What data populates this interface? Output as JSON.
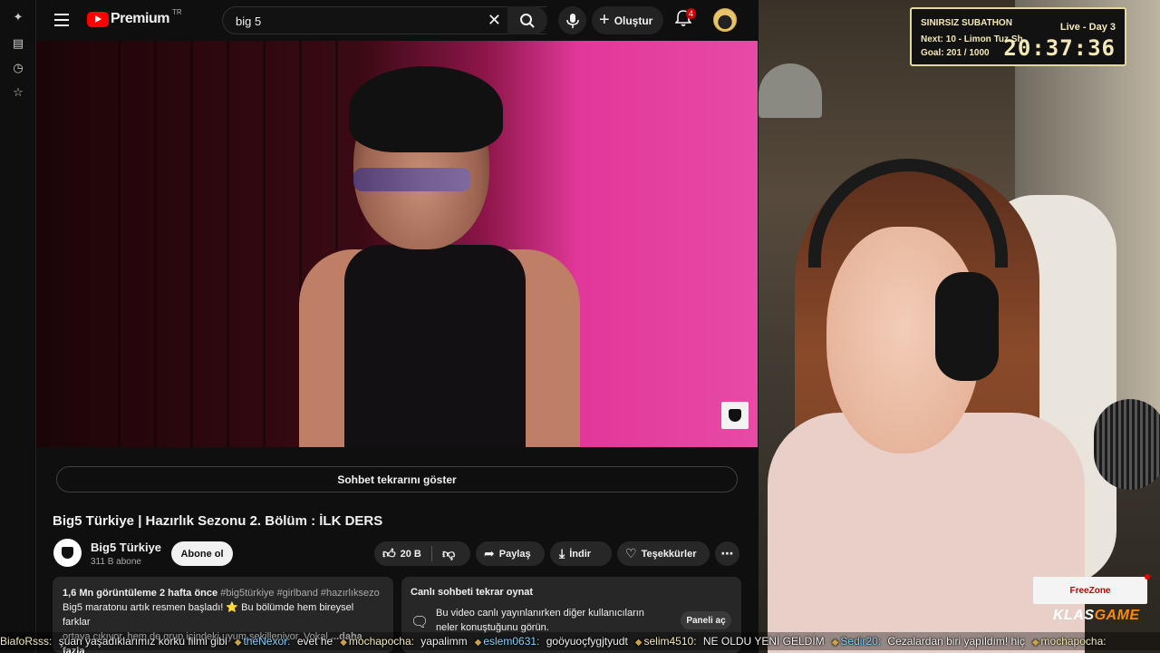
{
  "youtube": {
    "logo_text": "Premium",
    "region": "TR",
    "search_value": "big 5",
    "create_label": "Oluştur",
    "notif_count": "4",
    "replay_label": "Sohbet tekrarını göster",
    "video_title": "Big5 Türkiye | Hazırlık Sezonu 2. Bölüm : İLK DERS",
    "channel": {
      "name": "Big5 Türkiye",
      "subs": "311 B abone"
    },
    "subscribe_label": "Abone ol",
    "like_count": "20 B",
    "share_label": "Paylaş",
    "download_label": "İndir",
    "thanks_label": "Teşekkürler",
    "description": {
      "meta": "1,6 Mn görüntüleme  2 hafta önce",
      "tags": " #big5türkiye #girlband #hazırlıksezo",
      "line2": "Big5 maratonu artık resmen başladı! ⭐ Bu bölümde hem bireysel farklar",
      "line3": "ortaya çıkıyor, hem de grup içindeki uyum şekilleniyor. Vokal",
      "more": "...daha fazla"
    },
    "live_chat": {
      "title": "Canlı sohbeti tekrar oynat",
      "text": "Bu video canlı yayınlanırken diğer kullanıcıların neler konuştuğunu görün.",
      "button": "Paneli aç"
    }
  },
  "subathon": {
    "title": "SINIRSIZ SUBATHON",
    "next": "Next: 10 - Limon Tuz Sh",
    "goal": "Goal: 201 / 1000",
    "status": "Live - Day 3",
    "timer": "20:37:36"
  },
  "sponsor": {
    "freezone": "FreeZone",
    "klas": "KLAS",
    "game": "GAME"
  },
  "ticker": [
    {
      "user": "BiafoRsss:",
      "msg": " şuan yaşadıklarımız korku filmi gibi"
    },
    {
      "user": "theNexor:",
      "msg": " evet he"
    },
    {
      "user": "mochapocha:",
      "msg": " yapalimm"
    },
    {
      "user": "eslem0631:",
      "msg": " goöyuoçfygjtyudt"
    },
    {
      "user": "selim4510:",
      "msg": " NE OLDU YENİ GELDİM"
    },
    {
      "user": "Sedir20:",
      "msg": " Cezalardan biri yapıldım! hiç"
    },
    {
      "user": "mochapocha:",
      "msg": ""
    }
  ],
  "colors": {
    "accent": "#ff0000",
    "subathon_border": "#e4d99a",
    "ticker_user": "#7fd4ff"
  }
}
